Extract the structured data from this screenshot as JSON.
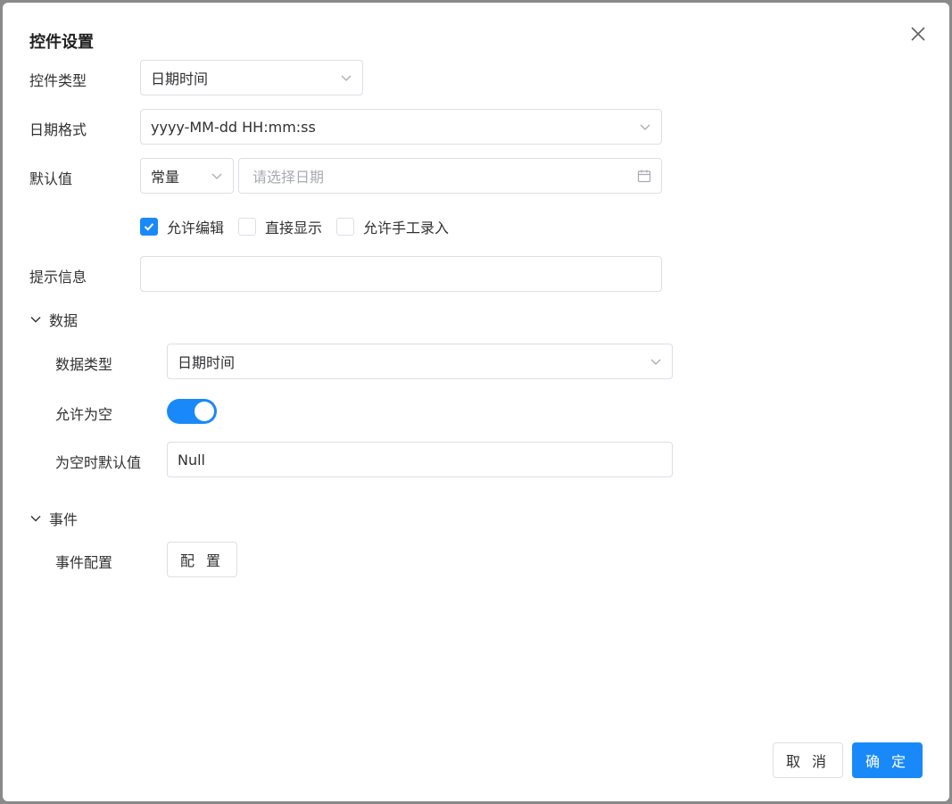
{
  "dialog": {
    "title": "控件设置"
  },
  "form": {
    "control_type": {
      "label": "控件类型",
      "value": "日期时间"
    },
    "date_format": {
      "label": "日期格式",
      "value": "yyyy-MM-dd HH:mm:ss"
    },
    "default_value": {
      "label": "默认值",
      "mode": "常量",
      "date_placeholder": "请选择日期"
    },
    "options": [
      {
        "label": "允许编辑",
        "checked": true
      },
      {
        "label": "直接显示",
        "checked": false
      },
      {
        "label": "允许手工录入",
        "checked": false
      }
    ],
    "hint": {
      "label": "提示信息",
      "value": ""
    }
  },
  "data_section": {
    "title": "数据",
    "data_type": {
      "label": "数据类型",
      "value": "日期时间"
    },
    "allow_empty": {
      "label": "允许为空",
      "on": true
    },
    "empty_default": {
      "label": "为空时默认值",
      "value": "Null"
    }
  },
  "event_section": {
    "title": "事件",
    "event_config": {
      "label": "事件配置",
      "button": "配 置"
    }
  },
  "footer": {
    "cancel": "取 消",
    "confirm": "确 定"
  },
  "colors": {
    "primary": "#1989fa",
    "border": "#dcdfe6",
    "placeholder": "#a8abb2"
  },
  "icons": {
    "close": "close-icon",
    "chevron": "chevron-down-icon",
    "calendar": "calendar-icon",
    "check": "check-icon"
  }
}
